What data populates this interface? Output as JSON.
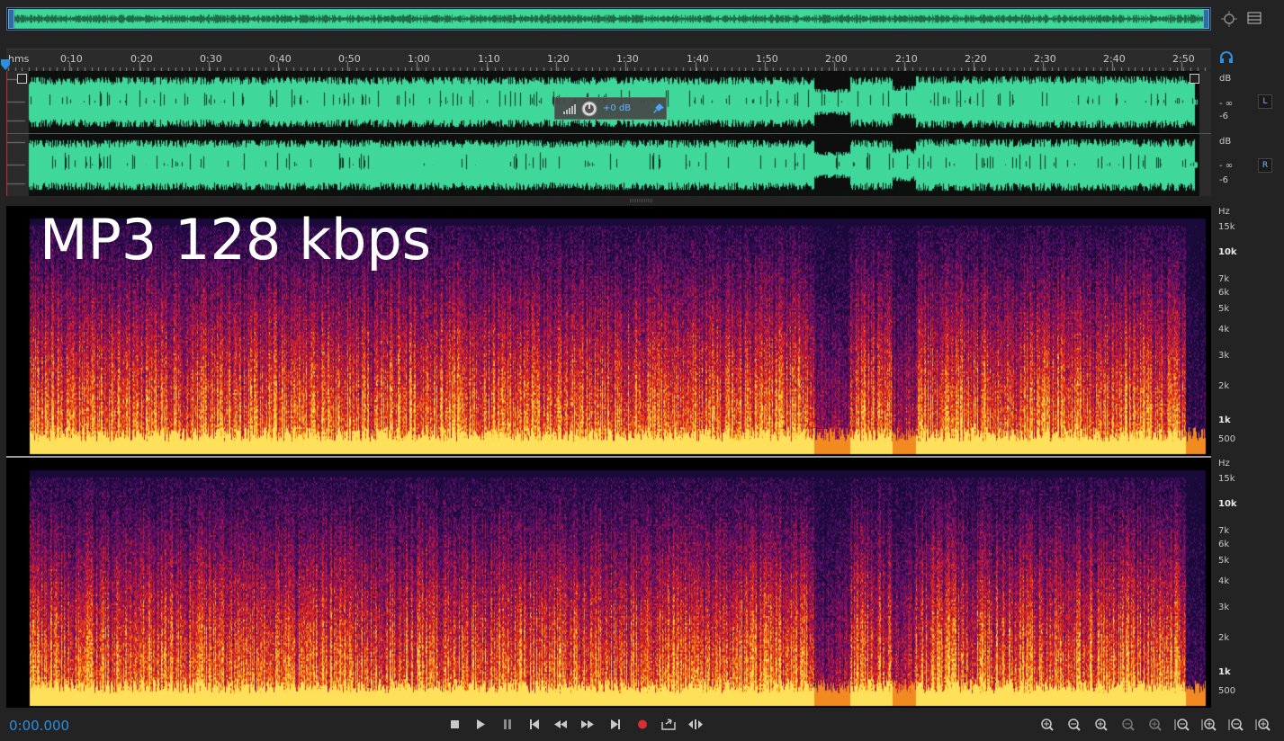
{
  "overlay": {
    "title": "MP3 128 kbps"
  },
  "ruler": {
    "unit": "hms",
    "ticks": [
      "0:10",
      "0:20",
      "0:30",
      "0:40",
      "0:50",
      "1:00",
      "1:10",
      "1:20",
      "1:30",
      "1:40",
      "1:50",
      "2:00",
      "2:10",
      "2:20",
      "2:30",
      "2:40",
      "2:50"
    ]
  },
  "waveform": {
    "channels": [
      {
        "badge": "L",
        "scale": [
          "dB",
          "- ∞",
          "-6"
        ]
      },
      {
        "badge": "R",
        "scale": [
          "dB",
          "- ∞",
          "-6"
        ]
      }
    ],
    "hud_value": "+0 dB"
  },
  "spectral": {
    "unit": "Hz",
    "ticks": [
      "15k",
      "10k",
      "7k",
      "6k",
      "5k",
      "4k",
      "3k",
      "2k",
      "1k",
      "500"
    ]
  },
  "transport": {
    "time": "0:00.000",
    "buttons": [
      "stop-icon",
      "play-icon",
      "pause-icon",
      "skip-to-start-icon",
      "rewind-icon",
      "fast-forward-icon",
      "skip-to-end-icon",
      "record-icon",
      "loop-playback-icon",
      "skip-selection-icon"
    ]
  },
  "zoom": {
    "buttons": [
      "zoom-in-amplitude-icon",
      "zoom-out-amplitude-icon",
      "zoom-in-time-icon",
      "zoom-out-time-icon",
      "zoom-out-full-icon",
      "zoom-in-point-icon",
      "zoom-out-point-icon",
      "zoom-selection-icon",
      "zoom-in-spectral-icon"
    ]
  },
  "colors": {
    "waveform": "#3fd89a",
    "accent": "#2d8fdf",
    "record": "#d83030"
  }
}
